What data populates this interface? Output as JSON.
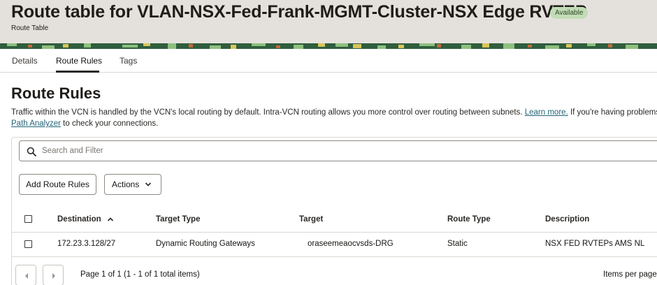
{
  "header": {
    "title": "Route table for VLAN-NSX-Fed-Frank-MGMT-Cluster-NSX Edge RVTEP",
    "status": "Available",
    "subtitle": "Route Table"
  },
  "colors": {
    "status_badge": "#c3dcb7",
    "link": "#226477",
    "header_bg": "#e4e1dc"
  },
  "tabs": [
    {
      "label": "Details",
      "active": false
    },
    {
      "label": "Route Rules",
      "active": true
    },
    {
      "label": "Tags",
      "active": false
    }
  ],
  "section": {
    "title": "Route Rules",
    "desc_part1": "Traffic within the VCN is handled by the VCN's local routing by default. Intra-VCN routing allows you more control over routing between subnets. ",
    "desc_link1": "Learn more.",
    "desc_part2": " If you're having problems, ",
    "desc_link2": "Path Analyzer",
    "desc_part3": " to check your connections."
  },
  "search": {
    "placeholder": "Search and Filter",
    "value": ""
  },
  "toolbar": {
    "add_label": "Add Route Rules",
    "actions_label": "Actions"
  },
  "table": {
    "columns": [
      "Destination",
      "Target Type",
      "Target",
      "Route Type",
      "Description"
    ],
    "sort_column": "Destination",
    "sort_direction": "ascending",
    "rows": [
      {
        "destination": "172.23.3.128/27",
        "target_type": "Dynamic Routing Gateways",
        "target": "oraseemeaocvsds-DRG",
        "route_type": "Static",
        "description": "NSX FED RVTEPs AMS NL"
      }
    ]
  },
  "pagination": {
    "text": "Page 1 of 1 (1 - 1 of 1 total items)",
    "items_per_page_label": "Items per page"
  },
  "icons": {
    "search": "search-icon",
    "sort": "sort-ascending-icon",
    "actions": "chevron-down-icon",
    "prev": "chevron-left-icon",
    "next": "chevron-right-icon"
  }
}
